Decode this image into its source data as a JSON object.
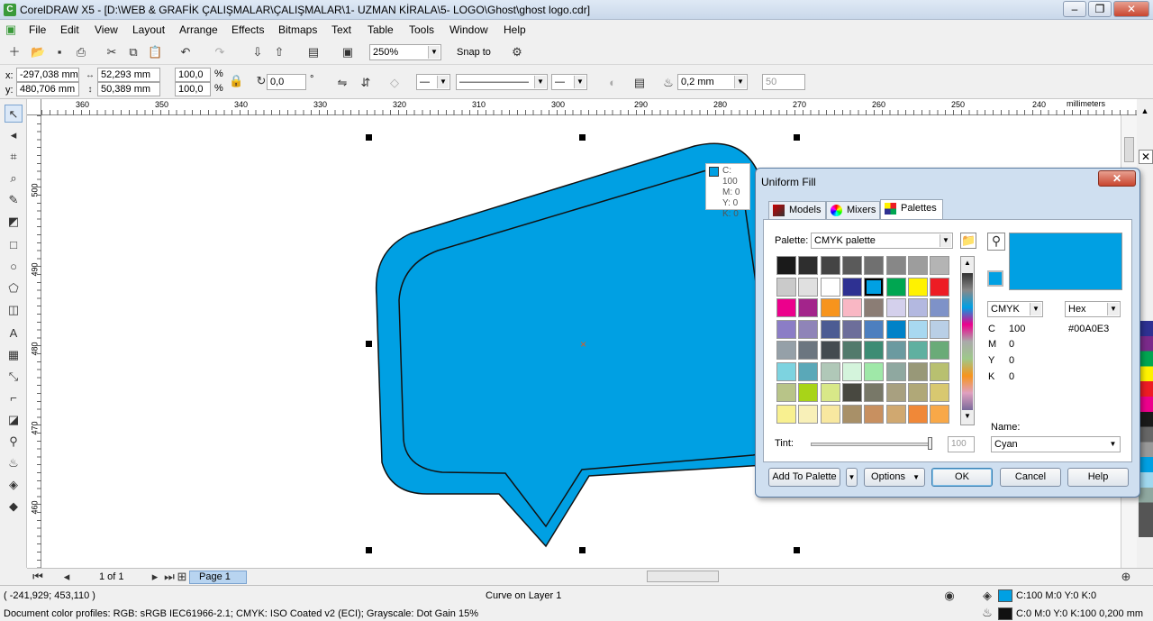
{
  "title": "CorelDRAW X5 - [D:\\WEB & GRAFİK ÇALIŞMALAR\\ÇALIŞMALAR\\1- UZMAN KİRALA\\5- LOGO\\Ghost\\ghost logo.cdr]",
  "menu": [
    "File",
    "Edit",
    "View",
    "Layout",
    "Arrange",
    "Effects",
    "Bitmaps",
    "Text",
    "Table",
    "Tools",
    "Window",
    "Help"
  ],
  "toolbar": {
    "zoom": "250%",
    "snap_to": "Snap to"
  },
  "props": {
    "x": "-297,038 mm",
    "y": "480,706 mm",
    "w": "52,293 mm",
    "h": "50,389 mm",
    "sx": "100,0",
    "sy": "100,0",
    "pct": "%",
    "pct2": "%",
    "angle": "0,0",
    "deg": "°",
    "outline": "0,2 mm",
    "x_label": "x:",
    "y_label": "y:",
    "fifty": "50"
  },
  "ruler": {
    "h": [
      "360",
      "350",
      "340",
      "330",
      "320",
      "310",
      "300",
      "290",
      "280",
      "270",
      "260",
      "250",
      "240"
    ],
    "unit": "millimeters",
    "v": [
      "500",
      "490",
      "480",
      "470",
      "460"
    ],
    "v_unit": "millimeters"
  },
  "tooltip": {
    "c": "C: 100",
    "m": "M: 0",
    "y": "Y: 0",
    "k": "K: 0"
  },
  "dialog": {
    "title": "Uniform Fill",
    "tabs": [
      "Models",
      "Mixers",
      "Palettes"
    ],
    "palette_label": "Palette:",
    "palette_value": "CMYK palette",
    "model": "CMYK",
    "format": "Hex",
    "c_label": "C",
    "c": "100",
    "m_label": "M",
    "m": "0",
    "y_label": "Y",
    "y": "0",
    "k_label": "K",
    "k": "0",
    "hex": "#00A0E3",
    "name_label": "Name:",
    "name": "Cyan",
    "tint_label": "Tint:",
    "tint_value": "100",
    "add_to_palette": "Add To Palette",
    "options": "Options",
    "ok": "OK",
    "cancel": "Cancel",
    "help": "Help",
    "swatches": [
      "#1a1a1a",
      "#2e2e2e",
      "#444444",
      "#5a5a5a",
      "#707070",
      "#878787",
      "#9d9d9d",
      "#b4b4b4",
      "#cacaca",
      "#e0e0e0",
      "#ffffff",
      "#2e3192",
      "#00a0e3",
      "#00a651",
      "#fff200",
      "#ed1c24",
      "#ec008c",
      "#a3248b",
      "#f7941d",
      "#f9b7c4",
      "#8b7d75",
      "#d4d0ec",
      "#b3b8e0",
      "#7e92c8",
      "#8b7dc6",
      "#8f84b8",
      "#4c5c93",
      "#6d6e9a",
      "#4d7fbf",
      "#0082c8",
      "#a8d8f0",
      "#b9cfe6",
      "#95a0a8",
      "#6c7680",
      "#444b50",
      "#527a6c",
      "#3d8c74",
      "#6b9aa0",
      "#5fb0a0",
      "#6aab78",
      "#7dd3e0",
      "#5aa8b8",
      "#b0c8b8",
      "#d4f4dc",
      "#9fe8a8",
      "#8fa8a0",
      "#989878",
      "#b8c070",
      "#b8c488",
      "#a8d418",
      "#d8e888",
      "#484840",
      "#787868",
      "#a8a080",
      "#b0a878",
      "#d8c870",
      "#f8f090",
      "#f8f0b8",
      "#f8e8a0",
      "#a89068",
      "#c89060",
      "#d0a870",
      "#f08838",
      "#f8a848"
    ],
    "preview": "#00a0e3"
  },
  "pagebar": {
    "page_of": "1 of 1",
    "page": "Page 1"
  },
  "status": {
    "coords": "( -241,929; 453,110 )",
    "selection": "Curve on Layer 1",
    "profiles": "Document color profiles: RGB: sRGB IEC61966-2.1; CMYK: ISO Coated v2 (ECI); Grayscale: Dot Gain 15%",
    "fill": "C:100 M:0 Y:0 K:0",
    "outline": "C:0 M:0 Y:0 K:100  0,200 mm"
  },
  "colors": {
    "cyan": "#00a0e3"
  }
}
